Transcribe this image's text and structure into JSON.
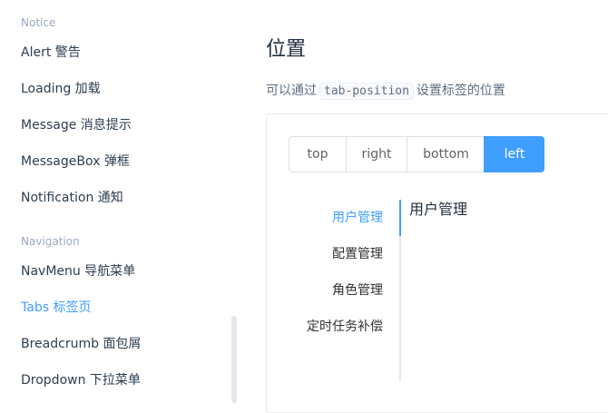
{
  "sidebar": {
    "groups": [
      {
        "title": "Notice",
        "items": [
          {
            "label": "Alert 警告"
          },
          {
            "label": "Loading 加载"
          },
          {
            "label": "Message 消息提示"
          },
          {
            "label": "MessageBox 弹框"
          },
          {
            "label": "Notification 通知"
          }
        ]
      },
      {
        "title": "Navigation",
        "items": [
          {
            "label": "NavMenu 导航菜单"
          },
          {
            "label": "Tabs 标签页"
          },
          {
            "label": "Breadcrumb 面包屑"
          },
          {
            "label": "Dropdown 下拉菜单"
          }
        ]
      }
    ],
    "active_item": "Tabs 标签页"
  },
  "main": {
    "title": "位置",
    "description": {
      "prefix": "可以通过",
      "code": "tab-position",
      "suffix": "设置标签的位置"
    },
    "position_options": [
      {
        "label": "top"
      },
      {
        "label": "right"
      },
      {
        "label": "bottom"
      },
      {
        "label": "left"
      }
    ],
    "selected_position": "left",
    "tabs": [
      {
        "label": "用户管理"
      },
      {
        "label": "配置管理"
      },
      {
        "label": "角色管理"
      },
      {
        "label": "定时任务补偿"
      }
    ],
    "active_tab": "用户管理",
    "tab_content": "用户管理"
  },
  "colors": {
    "accent": "#409eff",
    "text_primary": "#2c3e50",
    "group_title": "#99a9bf",
    "border": "#dcdfe6"
  }
}
